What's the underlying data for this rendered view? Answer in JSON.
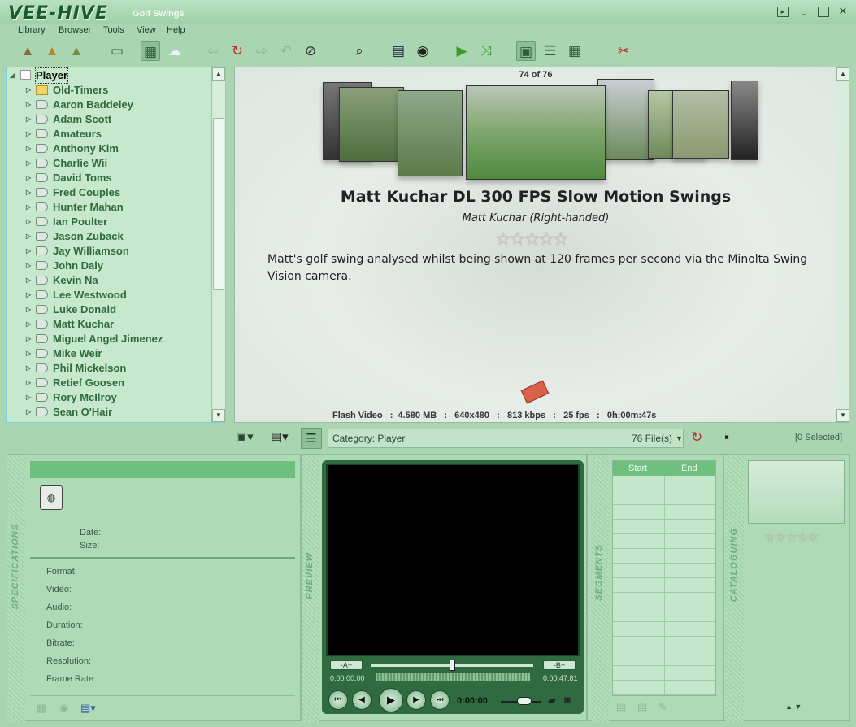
{
  "app": {
    "logo": "VEE-HIVE",
    "window_title": "Golf Swings"
  },
  "menu": [
    "Library",
    "Browser",
    "Tools",
    "View",
    "Help"
  ],
  "tree": {
    "root": "Player",
    "items": [
      "Old-Timers",
      "Aaron Baddeley",
      "Adam Scott",
      "Amateurs",
      "Anthony Kim",
      "Charlie Wii",
      "David Toms",
      "Fred Couples",
      "Hunter Mahan",
      "Ian Poulter",
      "Jason Zuback",
      "Jay Williamson",
      "John Daly",
      "Kevin Na",
      "Lee Westwood",
      "Luke Donald",
      "Matt Kuchar",
      "Miguel Angel Jimenez",
      "Mike Weir",
      "Phil Mickelson",
      "Retief Goosen",
      "Rory McIlroy",
      "Sean O'Hair"
    ]
  },
  "detail": {
    "counter": "74 of 76",
    "title": "Matt Kuchar DL 300 FPS Slow Motion Swings",
    "subtitle": "Matt Kuchar (Right-handed)",
    "stars": "☆☆☆☆☆",
    "description": "Matt's golf swing analysed whilst being shown at 120 frames per second via the Minolta Swing Vision camera.",
    "fileinfo": "Flash Video   :  4.580 MB   :   640x480   :   813 kbps   :   25 fps   :   0h:00m:47s"
  },
  "category_bar": {
    "category": "Category: Player",
    "file_count": "76 File(s)",
    "selected": "[0 Selected]"
  },
  "specifications": {
    "section_label": "SPECIFICATIONS",
    "date_label": "Date:",
    "size_label": "Size:",
    "fields": [
      "Format:",
      "Video:",
      "Audio:",
      "Duration:",
      "Bitrate:",
      "Resolution:",
      "Frame Rate:"
    ]
  },
  "preview": {
    "section_label": "PREVIEW",
    "a_label": "A",
    "b_label": "B",
    "time_a": "0:00:00.00",
    "time_b": "0:00:47.81",
    "position": "0:00:00",
    "seek_fraction": 0.5
  },
  "segments": {
    "section_label": "SEGMENTS",
    "col_start": "Start",
    "col_end": "End"
  },
  "cataloguing": {
    "section_label": "CATALOGUING",
    "stars": "☆☆☆☆☆"
  }
}
